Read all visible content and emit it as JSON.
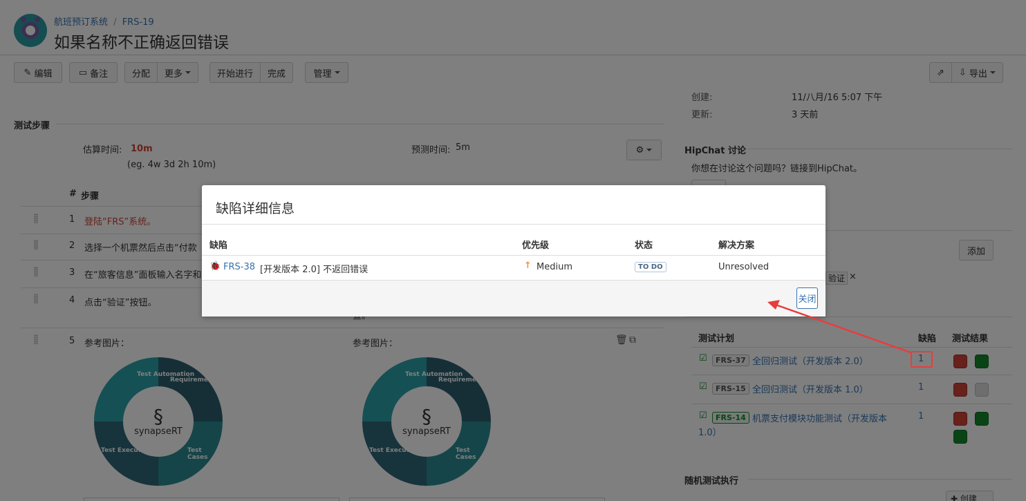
{
  "header": {
    "project": "航班预订系统",
    "issue_key": "FRS-19",
    "title": "如果名称不正确返回错误"
  },
  "toolbar": {
    "edit": "编辑",
    "comment": "备注",
    "assign": "分配",
    "more": "更多",
    "start": "开始进行",
    "done": "完成",
    "admin": "管理",
    "export": "导出"
  },
  "test_steps": {
    "section_title": "测试步骤",
    "estimate_label": "估算时间:",
    "estimate_value": "10m",
    "estimate_hint": "(eg. 4w 3d 2h 10m)",
    "predicted_label": "预测时间:",
    "predicted_value": "5m",
    "col_num": "#",
    "col_step": "步骤",
    "steps": [
      {
        "num": "1",
        "text": "登陆“FRS”系统。"
      },
      {
        "num": "2",
        "text": "选择一个机票然后点击“付款"
      },
      {
        "num": "3",
        "text": "在“旅客信息”面板输入名字和"
      },
      {
        "num": "4",
        "text": "点击“验证”按钮。"
      },
      {
        "num": "5",
        "text": "参考图片："
      }
    ],
    "step4_tail": "查。",
    "ref_image_label_2": "参考图片：",
    "graphic": {
      "brand": "synapseRT",
      "q1": "Test Automation",
      "q2": "Requirements",
      "q3": "Test Execution",
      "q4": "Test Cases"
    }
  },
  "right_panel": {
    "created_label": "创建:",
    "created_value": "11/八月/16 5:07 下午",
    "updated_label": "更新:",
    "updated_value": "3 天前",
    "hipchat_title": "HipChat 讨论",
    "hipchat_text": "你想在讨论这个问题吗？链接到HipChat。",
    "add_label": "添加",
    "tag_text": "验证",
    "tag_remove": "×",
    "test_plans": {
      "col_plan": "测试计划",
      "col_defects": "缺陷",
      "col_results": "测试结果",
      "rows": [
        {
          "key": "FRS-37",
          "name": "全回归测试（开发版本 2.0）",
          "defects": "1"
        },
        {
          "key": "FRS-15",
          "name": "全回归测试（开发版本 1.0）",
          "defects": "1"
        },
        {
          "key": "FRS-14",
          "name": "机票支付模块功能测试（开发版本",
          "name_cont": "1.0）",
          "defects": "1"
        }
      ]
    },
    "random_exec_title": "随机测试执行",
    "create_label": "创建"
  },
  "dialog": {
    "title": "缺陷详细信息",
    "col_defect": "缺陷",
    "col_priority": "优先级",
    "col_status": "状态",
    "col_resolution": "解决方案",
    "row": {
      "key": "FRS-38",
      "summary": "[开发版本 2.0] 不返回错误",
      "priority": "Medium",
      "status": "TO DO",
      "resolution": "Unresolved"
    },
    "close_label": "关闭"
  },
  "colors": {
    "link": "#3572b0",
    "arrow": "#e83d3d",
    "teal": "#2a8a92"
  }
}
